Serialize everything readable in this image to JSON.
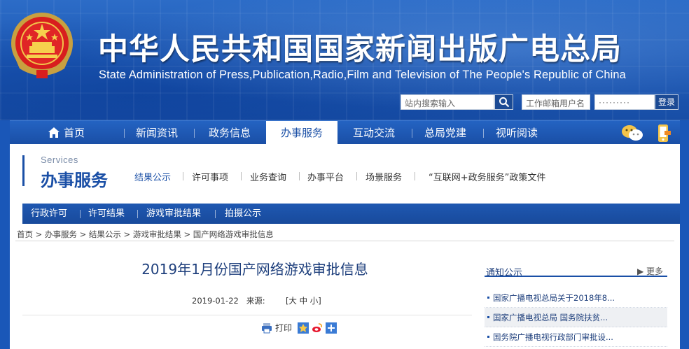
{
  "header": {
    "title_cn": "中华人民共和国国家新闻出版广电总局",
    "title_en": "State Administration of Press,Publication,Radio,Film and Television of The People's Republic of China",
    "search_placeholder": "站内搜索输入",
    "email_placeholder": "工作邮箱用户名",
    "password_mask": "·········",
    "login_label": "登录"
  },
  "nav": {
    "items": [
      {
        "label": "首页"
      },
      {
        "label": "新闻资讯"
      },
      {
        "label": "政务信息"
      },
      {
        "label": "办事服务"
      },
      {
        "label": "互动交流"
      },
      {
        "label": "总局党建"
      },
      {
        "label": "视听阅读"
      }
    ],
    "active": "办事服务"
  },
  "services": {
    "en": "Services",
    "cn": "办事服务",
    "tabs": [
      {
        "label": "结果公示"
      },
      {
        "label": "许可事项"
      },
      {
        "label": "业务查询"
      },
      {
        "label": "办事平台"
      },
      {
        "label": "场景服务"
      },
      {
        "label": "“互联网+政务服务”政策文件"
      }
    ],
    "subnav": [
      {
        "label": "行政许可"
      },
      {
        "label": "许可结果"
      },
      {
        "label": "游戏审批结果"
      },
      {
        "label": "拍摄公示"
      }
    ]
  },
  "breadcrumb": "首页 > 办事服务 > 结果公示 > 游戏审批结果 > 国产网络游戏审批信息",
  "article": {
    "title": "2019年1月份国产网络游戏审批信息",
    "date": "2019-01-22",
    "source_label": "来源:",
    "font_size": "[大 中 小]",
    "print_label": "打印"
  },
  "sidebar": {
    "title": "通知公示",
    "more_label": "▶ 更多",
    "items": [
      {
        "label": "国家广播电视总局关于2018年8..."
      },
      {
        "label": "国家广播电视总局 国务院扶贫..."
      },
      {
        "label": "国务院广播电视行政部门审批设..."
      }
    ]
  },
  "colors": {
    "brand_blue": "#1a4fa6",
    "title_blue": "#1e3f7c"
  }
}
